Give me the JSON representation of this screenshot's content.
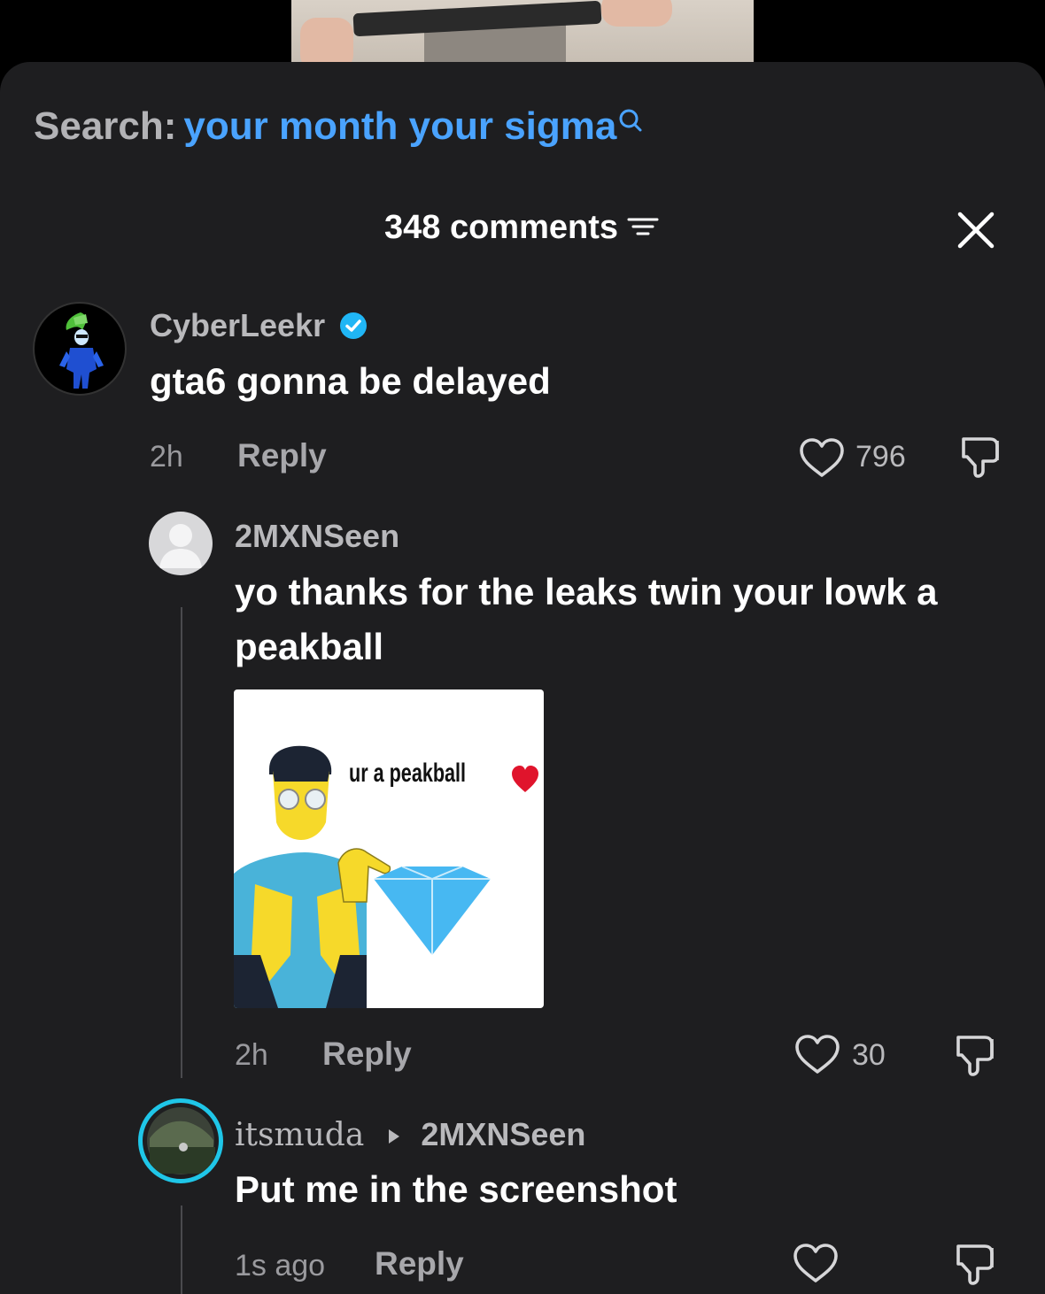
{
  "search": {
    "label": "Search:",
    "query": "your month your sigma"
  },
  "header": {
    "comment_count": "348 comments"
  },
  "comments": [
    {
      "username": "CyberLeekr",
      "verified": true,
      "text": "gta6 gonna be delayed",
      "time": "2h",
      "reply": "Reply",
      "likes": "796"
    },
    {
      "username": "2MXNSeen",
      "text": "yo thanks for the leaks twin your lowk a peakball",
      "image_caption": "ur a peakball",
      "time": "2h",
      "reply": "Reply",
      "likes": "30"
    },
    {
      "username": "itsmuda",
      "reply_to": "2MXNSeen",
      "text": "Put me in the screenshot",
      "time": "1s ago",
      "reply": "Reply",
      "likes": ""
    }
  ],
  "colors": {
    "accent": "#4aa3ff",
    "sheet": "#1e1e20",
    "verified": "#20b6f5",
    "story_ring": "#1fc6e8"
  },
  "icons": [
    "search-icon",
    "filter-icon",
    "close-icon",
    "verified-badge-icon",
    "heart-icon",
    "dislike-icon",
    "caret-right-icon",
    "heart-emoji-icon",
    "diamond-icon"
  ]
}
